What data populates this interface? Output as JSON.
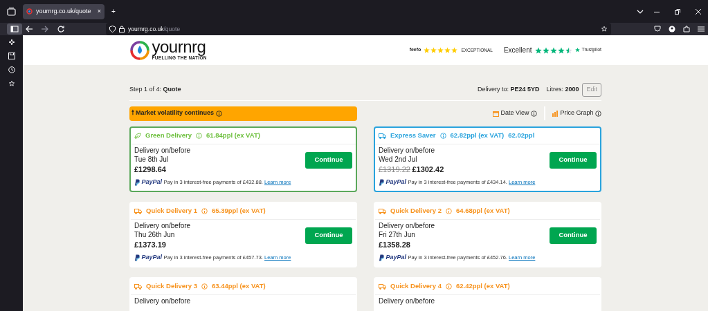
{
  "browser": {
    "tab_title": "yournrg.co.uk/quote",
    "tab_close": "×",
    "new_tab": "+",
    "url_host": "yournrg.co.uk",
    "url_path": "/quote"
  },
  "header": {
    "logo_text": "yournrg",
    "logo_tagline": "FUELLING THE NATION",
    "feefo": {
      "name": "feefo",
      "stars": 5,
      "rating": "EXCEPTIONAL"
    },
    "trustpilot": {
      "rating": "Excellent",
      "stars": 4.5,
      "name": "Trustpilot"
    }
  },
  "step": "Step 1 of 4: **Quote**",
  "delivery_to": "Delivery to: **PE24 5YD**",
  "litres": "Litres: **2000**",
  "edit_button": {
    "label": "Edit",
    "disabled": true
  },
  "alert": {
    "icon": "🠕",
    "text": "Market volatility continues"
  },
  "views": [
    {
      "label": "Date View",
      "kind": "calendar"
    },
    {
      "label": "Price Graph",
      "kind": "chart"
    }
  ],
  "options": [
    {
      "kind": "green",
      "title": "Green Delivery",
      "ppl": "61.84ppl (ex VAT)",
      "delivery_label": "Delivery on/before",
      "date": "Tue 8th Jul",
      "price": "£1298.64",
      "button": "Continue",
      "paypal_logo": "PayPal",
      "paypal_text": "Pay in 3 interest-free payments of £432.88.",
      "paypal_link": "Learn more"
    },
    {
      "kind": "express",
      "title": "Express Saver",
      "ppl": "62.82ppl (ex VAT)",
      "discount_ppl": "62.02ppl",
      "delivery_label": "Delivery on/before",
      "date": "Wed 2nd Jul",
      "old_price": "£1319.22",
      "price": "£1302.42",
      "button": "Continue",
      "paypal_logo": "PayPal",
      "paypal_text": "Pay in 3 interest-free payments of £434.14.",
      "paypal_link": "Learn more"
    },
    {
      "kind": "quick",
      "title": "Quick Delivery 1",
      "ppl": "65.39ppl (ex VAT)",
      "delivery_label": "Delivery on/before",
      "date": "Thu 26th Jun",
      "price": "£1373.19",
      "button": "Continue",
      "paypal_logo": "PayPal",
      "paypal_text": "Pay in 3 interest-free payments of £457.73.",
      "paypal_link": "Learn more"
    },
    {
      "kind": "quick",
      "title": "Quick Delivery 2",
      "ppl": "64.68ppl (ex VAT)",
      "delivery_label": "Delivery on/before",
      "date": "Fri 27th Jun",
      "price": "£1358.28",
      "button": "Continue",
      "paypal_logo": "PayPal",
      "paypal_text": "Pay in 3 interest-free payments of £452.76.",
      "paypal_link": "Learn more"
    },
    {
      "kind": "quick",
      "title": "Quick Delivery 3",
      "ppl": "63.44ppl (ex VAT)",
      "delivery_label": "Delivery on/before"
    },
    {
      "kind": "quick",
      "title": "Quick Delivery 4",
      "ppl": "62.42ppl (ex VAT)",
      "delivery_label": "Delivery on/before"
    }
  ]
}
